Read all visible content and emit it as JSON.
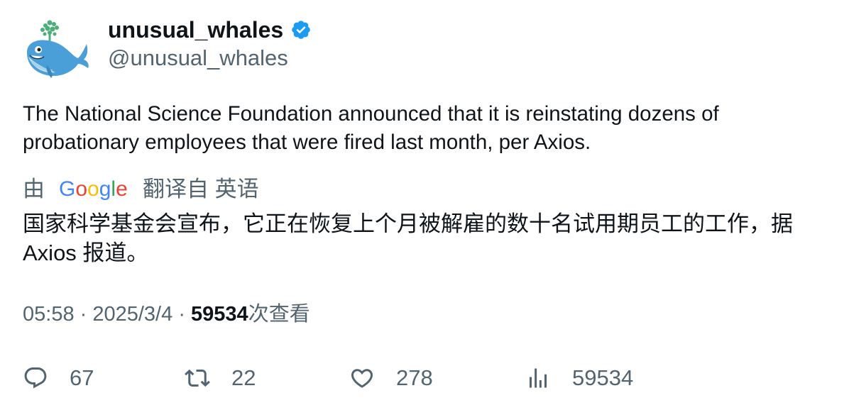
{
  "author": {
    "name": "unusual_whales",
    "handle": "@unusual_whales",
    "verified": true,
    "avatar_icon": "whale-logo"
  },
  "tweet": {
    "text": "The National Science Foundation announced that it is reinstating dozens of probationary employees that were fired last month, per Axios."
  },
  "translation": {
    "prefix": "由",
    "provider": "Google",
    "suffix": "翻译自 英语",
    "text": "国家科学基金会宣布，它正在恢复上个月被解雇的数十名试用期员工的工作，据 Axios 报道。"
  },
  "meta": {
    "time": "05:58",
    "date": "2025/3/4",
    "separator": "·",
    "views_count": "59534",
    "views_label": "次查看"
  },
  "actions": {
    "replies": "67",
    "retweets": "22",
    "likes": "278",
    "views": "59534"
  },
  "colors": {
    "verified_blue": "#1d9bf0",
    "secondary_text": "#536471",
    "primary_text": "#0f1419"
  }
}
